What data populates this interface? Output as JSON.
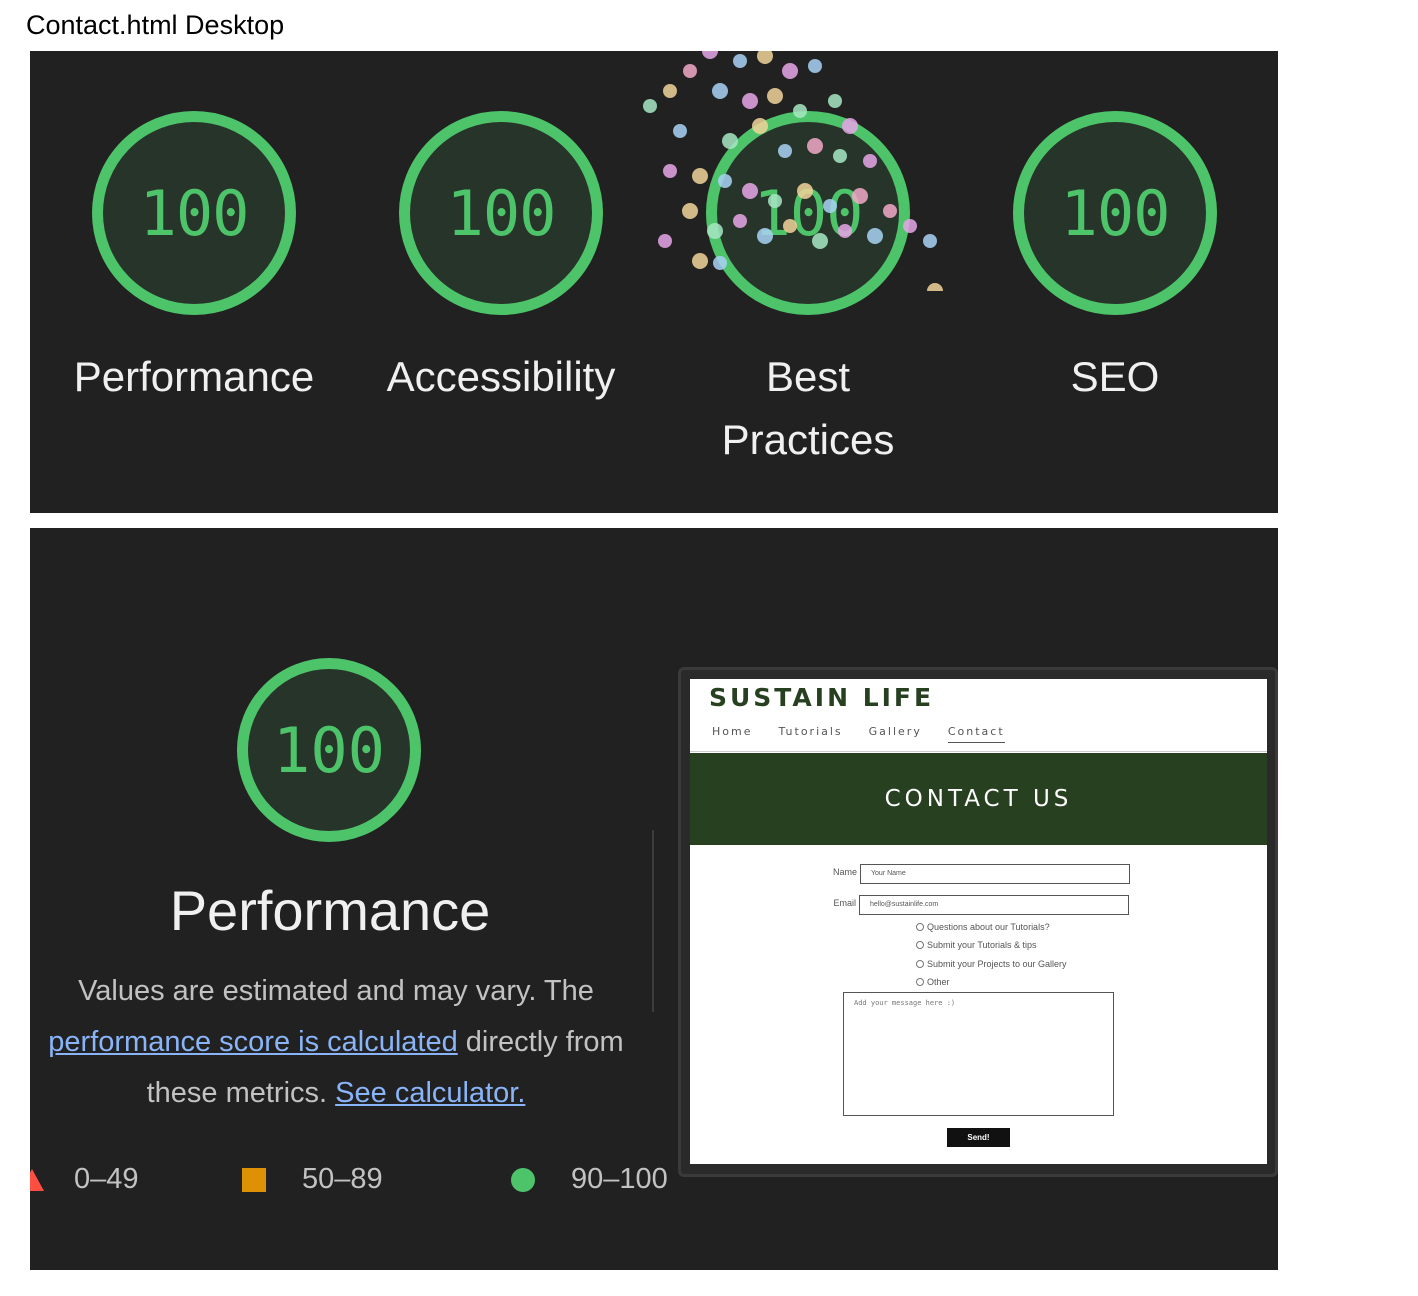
{
  "page": {
    "heading": "Contact.html Desktop"
  },
  "summary": {
    "gauges": [
      {
        "score": "100",
        "label": "Performance"
      },
      {
        "score": "100",
        "label": "Accessibility"
      },
      {
        "score": "100",
        "label": "Best Practices",
        "label_line1": "Best",
        "label_line2": "Practices"
      },
      {
        "score": "100",
        "label": "SEO"
      }
    ]
  },
  "detail": {
    "score": "100",
    "title": "Performance",
    "desc_line1": "Values are estimated and may vary. The",
    "desc_link1": "performance score is calculated",
    "desc_after_link1": " directly from",
    "desc_line3_prefix": "these metrics. ",
    "desc_link2": "See calculator.",
    "legend": {
      "fail": "0–49",
      "average": "50–89",
      "pass": "90–100"
    },
    "colors": {
      "pass": "#4ec46a",
      "average": "#ffa400",
      "fail": "#ff4e42",
      "link": "#8ab4f8"
    }
  },
  "screenshot": {
    "logo": "SUSTAIN LIFE",
    "nav": [
      "Home",
      "Tutorials",
      "Gallery",
      "Contact"
    ],
    "hero_title": "CONTACT US",
    "form": {
      "name_label": "Name",
      "name_placeholder": "Your Name",
      "email_label": "Email",
      "email_placeholder": "hello@sustainlife.com",
      "options": [
        "Questions about our Tutorials?",
        "Submit your Tutorials & tips",
        "Submit your Projects to our Gallery",
        "Other"
      ],
      "message_placeholder": "Add your message here :)",
      "send_label": "Send!"
    },
    "colors": {
      "brand_green": "#264020"
    }
  }
}
